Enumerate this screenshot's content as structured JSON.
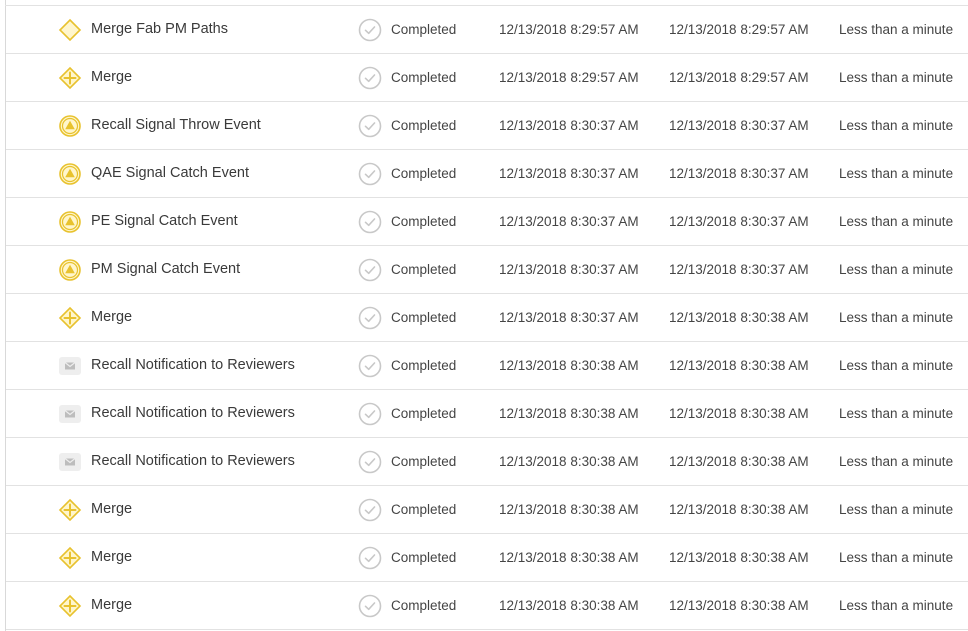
{
  "columns_note": "",
  "rows": [
    {
      "type": "diamond-icon",
      "name": "Merge Fab PM Paths",
      "status": "Completed",
      "start": "12/13/2018 8:29:57 AM",
      "end": "12/13/2018 8:29:57 AM",
      "duration": "Less than a minute"
    },
    {
      "type": "merge-diamond-plus-icon",
      "name": "Merge",
      "status": "Completed",
      "start": "12/13/2018 8:29:57 AM",
      "end": "12/13/2018 8:29:57 AM",
      "duration": "Less than a minute"
    },
    {
      "type": "signal-event-icon",
      "name": "Recall Signal Throw Event",
      "status": "Completed",
      "start": "12/13/2018 8:30:37 AM",
      "end": "12/13/2018 8:30:37 AM",
      "duration": "Less than a minute"
    },
    {
      "type": "signal-event-icon",
      "name": "QAE Signal Catch Event",
      "status": "Completed",
      "start": "12/13/2018 8:30:37 AM",
      "end": "12/13/2018 8:30:37 AM",
      "duration": "Less than a minute"
    },
    {
      "type": "signal-event-icon",
      "name": "PE Signal Catch Event",
      "status": "Completed",
      "start": "12/13/2018 8:30:37 AM",
      "end": "12/13/2018 8:30:37 AM",
      "duration": "Less than a minute"
    },
    {
      "type": "signal-event-icon",
      "name": "PM Signal Catch Event",
      "status": "Completed",
      "start": "12/13/2018 8:30:37 AM",
      "end": "12/13/2018 8:30:37 AM",
      "duration": "Less than a minute"
    },
    {
      "type": "merge-diamond-plus-icon",
      "name": "Merge",
      "status": "Completed",
      "start": "12/13/2018 8:30:37 AM",
      "end": "12/13/2018 8:30:38 AM",
      "duration": "Less than a minute"
    },
    {
      "type": "envelope-icon",
      "name": "Recall Notification to Reviewers",
      "status": "Completed",
      "start": "12/13/2018 8:30:38 AM",
      "end": "12/13/2018 8:30:38 AM",
      "duration": "Less than a minute"
    },
    {
      "type": "envelope-icon",
      "name": "Recall Notification to Reviewers",
      "status": "Completed",
      "start": "12/13/2018 8:30:38 AM",
      "end": "12/13/2018 8:30:38 AM",
      "duration": "Less than a minute"
    },
    {
      "type": "envelope-icon",
      "name": "Recall Notification to Reviewers",
      "status": "Completed",
      "start": "12/13/2018 8:30:38 AM",
      "end": "12/13/2018 8:30:38 AM",
      "duration": "Less than a minute"
    },
    {
      "type": "merge-diamond-plus-icon",
      "name": "Merge",
      "status": "Completed",
      "start": "12/13/2018 8:30:38 AM",
      "end": "12/13/2018 8:30:38 AM",
      "duration": "Less than a minute"
    },
    {
      "type": "merge-diamond-plus-icon",
      "name": "Merge",
      "status": "Completed",
      "start": "12/13/2018 8:30:38 AM",
      "end": "12/13/2018 8:30:38 AM",
      "duration": "Less than a minute"
    },
    {
      "type": "merge-diamond-plus-icon",
      "name": "Merge",
      "status": "Completed",
      "start": "12/13/2018 8:30:38 AM",
      "end": "12/13/2018 8:30:38 AM",
      "duration": "Less than a minute"
    }
  ],
  "colors": {
    "gateway_yellow": "#e8c22e",
    "gateway_fill": "#fff6cc",
    "check_gray": "#c8c8c8",
    "envelope_gray": "#bdbdbd",
    "row_border": "#e2e2e2",
    "text": "#3a3a3a"
  },
  "status_icon": "check-circle-icon"
}
